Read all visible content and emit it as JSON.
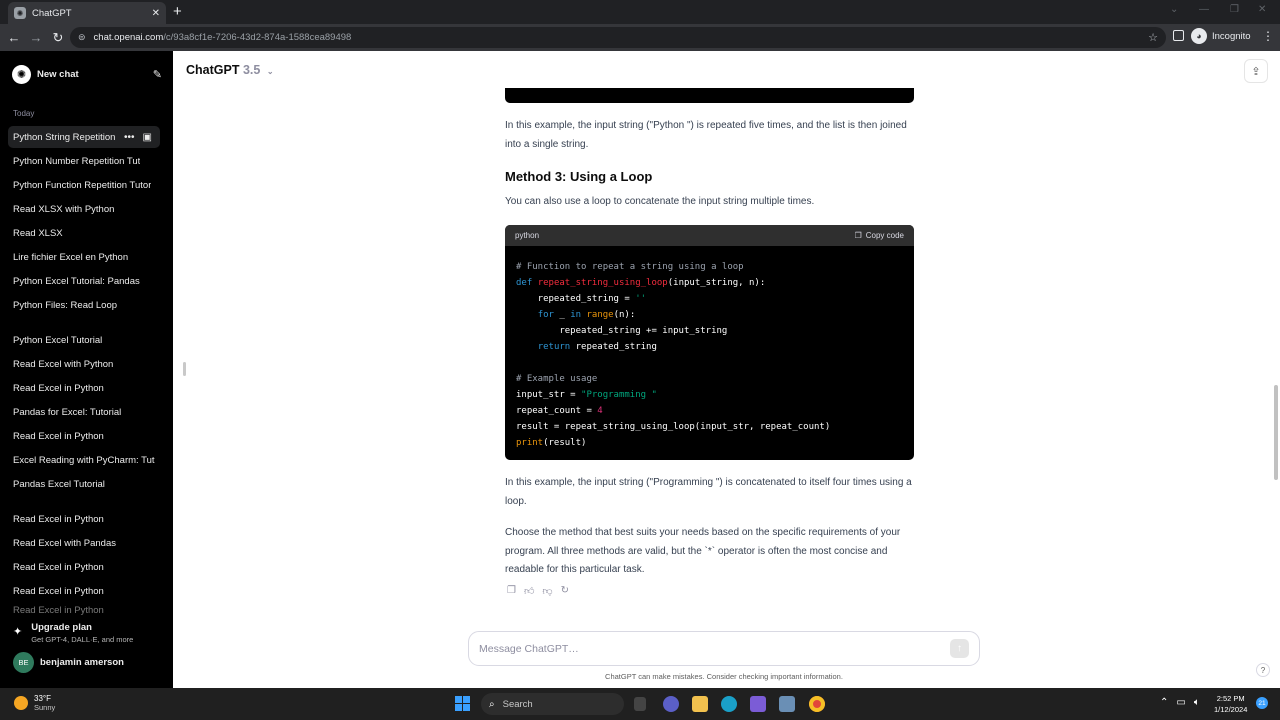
{
  "browser": {
    "tab_title": "ChatGPT",
    "url_host": "chat.openai.com",
    "url_path": "/c/93a8cf1e-7206-43d2-874a-1588cea89498",
    "incognito_label": "Incognito"
  },
  "sidebar": {
    "new_chat": "New chat",
    "section_today": "Today",
    "items": [
      "Python String Repetition",
      "Python Number Repetition Tut",
      "Python Function Repetition Tutor",
      "Read XLSX with Python",
      "Read XLSX",
      "Lire fichier Excel en Python",
      "Python Excel Tutorial: Pandas",
      "Python Files: Read Loop",
      "Python Excel Tutorial",
      "Read Excel with Python",
      "Read Excel in Python",
      "Pandas for Excel: Tutorial",
      "Read Excel in Python",
      "Excel Reading with PyCharm: Tut",
      "Pandas Excel Tutorial",
      "Read Excel in Python",
      "Read Excel with Pandas",
      "Read Excel in Python",
      "Read Excel in Python",
      "Read Excel in Python"
    ],
    "upgrade_title": "Upgrade plan",
    "upgrade_sub": "Get GPT-4, DALL·E, and more",
    "user_initials": "BE",
    "user_name": "benjamin amerson"
  },
  "header": {
    "model": "ChatGPT",
    "version": "3.5"
  },
  "content": {
    "para1": "In this example, the input string (\"Python \") is repeated five times, and the list is then joined into a single string.",
    "heading": "Method 3: Using a Loop",
    "para2": "You can also use a loop to concatenate the input string multiple times.",
    "code_lang": "python",
    "copy_label": "Copy code",
    "para3": "In this example, the input string (\"Programming \") is concatenated to itself four times using a loop.",
    "para4": "Choose the method that best suits your needs based on the specific requirements of your program. All three methods are valid, but the `*` operator is often the most concise and readable for this particular task."
  },
  "code": {
    "comment1": "# Function to repeat a string using a loop",
    "kw_def": "def",
    "fn_name": "repeat_string_using_loop",
    "sig_rest": "(input_string, n):",
    "line3_a": "    repeated_string = ",
    "empty_str": "''",
    "kw_for": "for",
    "under": " _ ",
    "kw_in": "in",
    "bi_range": "range",
    "range_args": "(n):",
    "line5": "        repeated_string += input_string",
    "kw_return": "return",
    "return_val": " repeated_string",
    "comment2": "# Example usage",
    "line8_a": "input_str = ",
    "str_prog": "\"Programming \"",
    "line9_a": "repeat_count = ",
    "num4": "4",
    "line10": "result = repeat_string_using_loop(input_str, repeat_count)",
    "bi_print": "print",
    "print_args": "(result)"
  },
  "composer": {
    "placeholder": "Message ChatGPT…",
    "disclaimer": "ChatGPT can make mistakes. Consider checking important information."
  },
  "taskbar": {
    "temp": "33°F",
    "condition": "Sunny",
    "search_label": "Search",
    "time": "2:52 PM",
    "date": "1/12/2024",
    "notifications": "21"
  }
}
